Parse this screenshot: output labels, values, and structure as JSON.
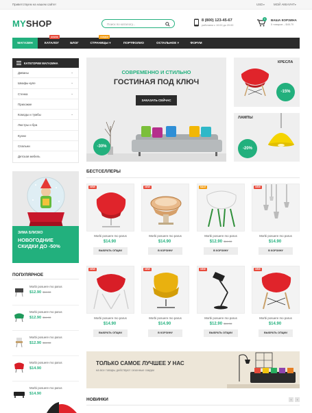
{
  "topbar": {
    "welcome": "Приветствуем на нашем сайте!",
    "currency": "USD",
    "account": "МОЙ АККАУНТ"
  },
  "header": {
    "logo_my": "MY",
    "logo_shop": "SHOP",
    "search_placeholder": "Поиск по каталогу...",
    "phone": "8 (800) 123-45-67",
    "hours": "работаем с 10:00 до 20:00",
    "cart_count": "0",
    "cart_title": "ВАША КОРЗИНА",
    "cart_summary": "5 товаров – $45.70"
  },
  "nav": {
    "items": [
      {
        "label": "Магазин"
      },
      {
        "label": "Каталог",
        "flag": "Новое"
      },
      {
        "label": "Блог"
      },
      {
        "label": "Страницы",
        "flag": "Скидки"
      },
      {
        "label": "Портфолио"
      },
      {
        "label": "Остальное"
      },
      {
        "label": "Форум"
      }
    ],
    "colors": {
      "new": "#e84c3d",
      "sale": "#f39c12"
    }
  },
  "sidebar": {
    "title": "Категории магазина",
    "categories": [
      {
        "label": "Диваны",
        "chevron": true
      },
      {
        "label": "Шкафы-купе",
        "chevron": true
      },
      {
        "label": "Стенка",
        "chevron": true
      },
      {
        "label": "Прихожие",
        "chevron": false
      },
      {
        "label": "Комоды и тумбы",
        "chevron": true
      },
      {
        "label": "Люстры и бра",
        "chevron": false
      },
      {
        "label": "Кухни",
        "chevron": false
      },
      {
        "label": "Спальни",
        "chevron": false
      },
      {
        "label": "Детская мебель",
        "chevron": false
      }
    ]
  },
  "hero": {
    "subtitle": "СОВРЕМЕННО И СТИЛЬНО",
    "title": "ГОСТИНАЯ ПОД КЛЮЧ",
    "button": "ЗАКАЗАТЬ СЕЙЧАС",
    "discount": "-30%"
  },
  "side_banners": [
    {
      "label": "КРЕСЛА",
      "discount": "-15%"
    },
    {
      "label": "ЛАМПЫ",
      "discount": "-20%"
    }
  ],
  "promo": {
    "line1": "ЗИМА БЛИЗКО",
    "line2": "НОВОГОДНИЕ",
    "line3": "СКИДКИ ДО -50%"
  },
  "bestsellers": {
    "title": "БЕСТСЕЛЛЕРЫ",
    "products": [
      {
        "name": "Morbi posuere mo parus",
        "price": "$14.90",
        "old": "",
        "button": "ВЫБРАТЬ ОПЦИИ",
        "badge": "NEW",
        "icon": "red-chair-icon"
      },
      {
        "name": "Morbi posuere mo parus",
        "price": "$14.90",
        "old": "",
        "button": "В КОРЗИНУ",
        "badge": "NEW",
        "icon": "bowl-icon"
      },
      {
        "name": "Morbi posuere mo parus",
        "price": "$12.90",
        "old": "$14.90",
        "button": "В КОРЗИНУ",
        "badge": "SALE",
        "icon": "white-chair-icon"
      },
      {
        "name": "Morbi posuere mo parus",
        "price": "$14.90",
        "old": "",
        "button": "В КОРЗИНУ",
        "badge": "NEW",
        "icon": "pendant-lamps-icon"
      },
      {
        "name": "Morbi posuere mo parus",
        "price": "$14.90",
        "old": "",
        "button": "ВЫБРАТЬ ОПЦИИ",
        "badge": "NEW",
        "icon": "red-wire-chair-icon"
      },
      {
        "name": "Morbi posuere mo parus",
        "price": "$14.90",
        "old": "",
        "button": "В КОРЗИНУ",
        "badge": "NEW",
        "icon": "yellow-chair-icon"
      },
      {
        "name": "Morbi posuere mo parus",
        "price": "$12.90",
        "old": "$14.90",
        "button": "ВЫБРАТЬ ОПЦИИ",
        "badge": "NEW",
        "icon": "desk-lamp-icon"
      },
      {
        "name": "Morbi posuere mo parus",
        "price": "$14.90",
        "old": "",
        "button": "ВЫБРАТЬ ОПЦИИ",
        "badge": "NEW",
        "icon": "red-eames-chair-icon"
      }
    ]
  },
  "popular": {
    "title": "ПОПУЛЯРНОЕ",
    "items": [
      {
        "name": "Morbi posuere mo parus",
        "price": "$12.90",
        "old": "$14.90"
      },
      {
        "name": "Morbi posuere mo parus",
        "price": "$12.90",
        "old": "$14.90"
      },
      {
        "name": "Morbi posuere mo parus",
        "price": "$12.90",
        "old": "$14.90"
      },
      {
        "name": "Morbi posuere mo parus",
        "price": "$14.90",
        "old": ""
      },
      {
        "name": "Morbi posuere mo parus",
        "price": "$14.90",
        "old": ""
      }
    ]
  },
  "wide_banner": {
    "title": "ТОЛЬКО САМОЕ ЛУЧШЕЕ У НАС",
    "subtitle": "на все товары действуют сезонные скидки"
  },
  "new_section": {
    "title": "НОВИНКИ"
  },
  "theme": {
    "accent": "#22b07d",
    "dark": "#2b2b2b",
    "new_badge": "#e84c3d",
    "sale_badge": "#f39c12"
  }
}
